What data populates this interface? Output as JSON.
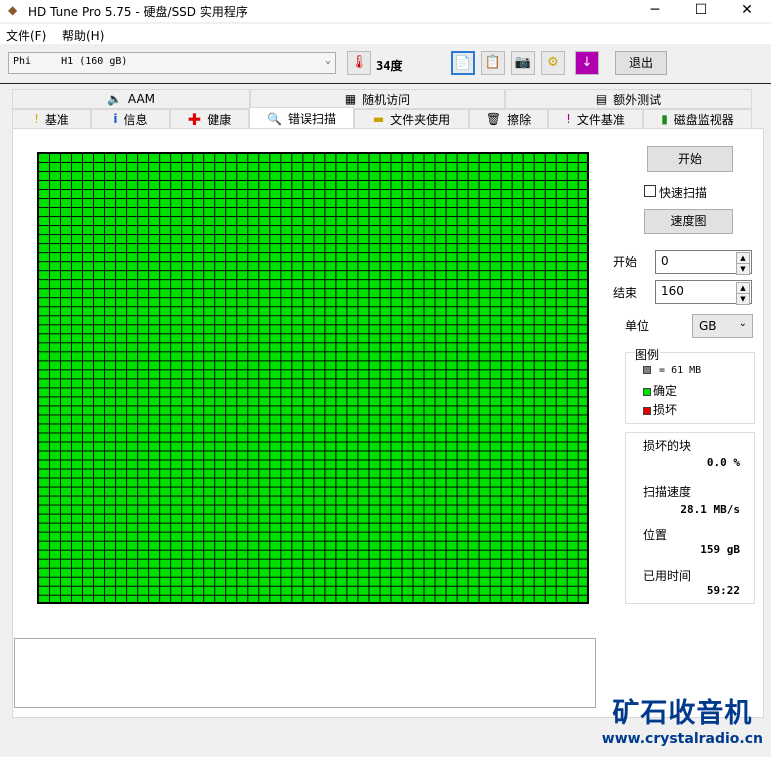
{
  "window": {
    "title": "HD Tune Pro 5.75 - 硬盘/SSD 实用程序",
    "minimize": "─",
    "maximize": "☐",
    "close": "✕"
  },
  "menu": [
    "文件(F)",
    "帮助(H)"
  ],
  "toolbar": {
    "drive": "Phi     H1 (160 gB)",
    "temperature": "34度",
    "exit": "退出"
  },
  "tabs_top": [
    {
      "label": "AAM",
      "icon": "speaker-icon"
    },
    {
      "label": "随机访问",
      "icon": "random-access-icon"
    },
    {
      "label": "额外测试",
      "icon": "extra-tests-icon"
    }
  ],
  "tabs_bottom": [
    {
      "label": "基准",
      "icon": "benchmark-icon"
    },
    {
      "label": "信息",
      "icon": "info-icon"
    },
    {
      "label": "健康",
      "icon": "health-icon"
    },
    {
      "label": "错误扫描",
      "icon": "magnifier-icon",
      "active": true
    },
    {
      "label": "文件夹使用",
      "icon": "folder-icon"
    },
    {
      "label": "擦除",
      "icon": "trash-icon"
    },
    {
      "label": "文件基准",
      "icon": "file-benchmark-icon"
    },
    {
      "label": "磁盘监视器",
      "icon": "disk-monitor-icon"
    }
  ],
  "scan": {
    "start_button": "开始",
    "quick_scan": "快速扫描",
    "quick_scan_checked": false,
    "speed_map": "速度图",
    "start_label": "开始",
    "start_value": "0",
    "end_label": "结束",
    "end_value": "160",
    "unit_label": "单位",
    "unit_value": "GB"
  },
  "legend": {
    "title": "图例",
    "block": "= 61 MB",
    "ok": "确定",
    "damaged": "损坏"
  },
  "stats": {
    "damaged_label": "损坏的块",
    "damaged_value": "0.0 %",
    "speed_label": "扫描速度",
    "speed_value": "28.1 MB/s",
    "position_label": "位置",
    "position_value": "159 gB",
    "elapsed_label": "已用时间",
    "elapsed_value": "59:22"
  },
  "colors": {
    "ok": "#00e000",
    "damaged": "#e00000",
    "block": "#808080"
  },
  "watermark": {
    "line1": "矿石收音机",
    "line2": "www.crystalradio.cn"
  }
}
